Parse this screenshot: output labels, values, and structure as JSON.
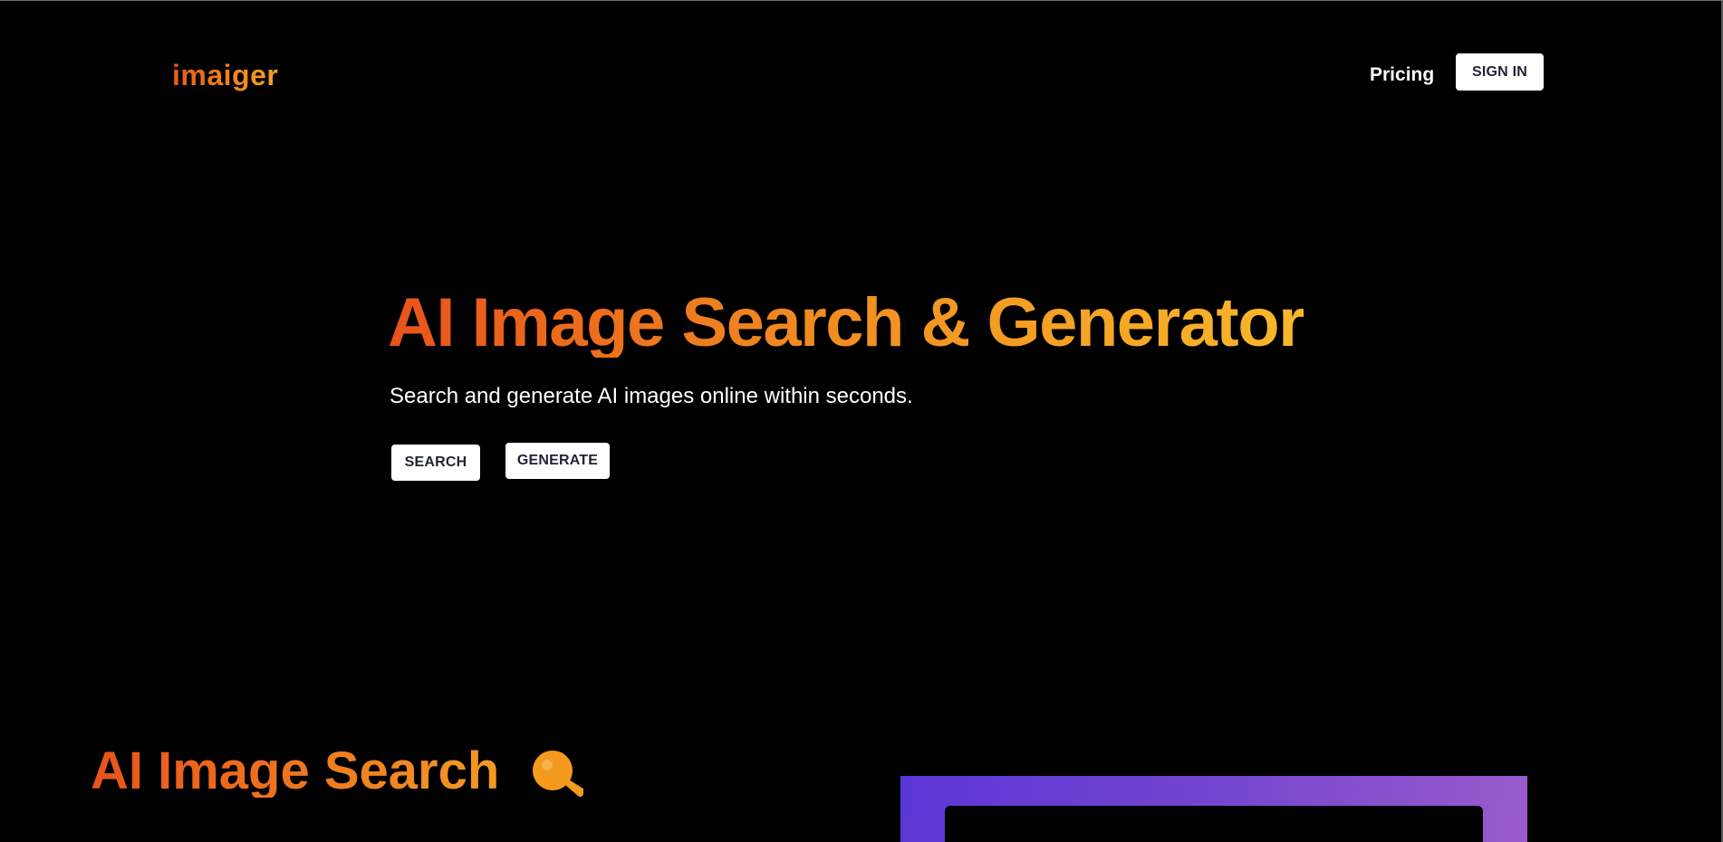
{
  "header": {
    "logo": "imaiger",
    "nav_pricing": "Pricing",
    "signin_label": "SIGN IN"
  },
  "hero": {
    "title": "AI Image Search & Generator",
    "subtitle": "Search and generate AI images online within seconds.",
    "search_label": "SEARCH",
    "generate_label": "GENERATE"
  },
  "section": {
    "title": "AI Image Search",
    "icon": "magnifier-icon"
  },
  "colors": {
    "background": "#000000",
    "accent_start": "#e8531a",
    "accent_end": "#f8b82a",
    "preview_gradient_start": "#5a36d6",
    "preview_gradient_end": "#9a5bcc"
  }
}
